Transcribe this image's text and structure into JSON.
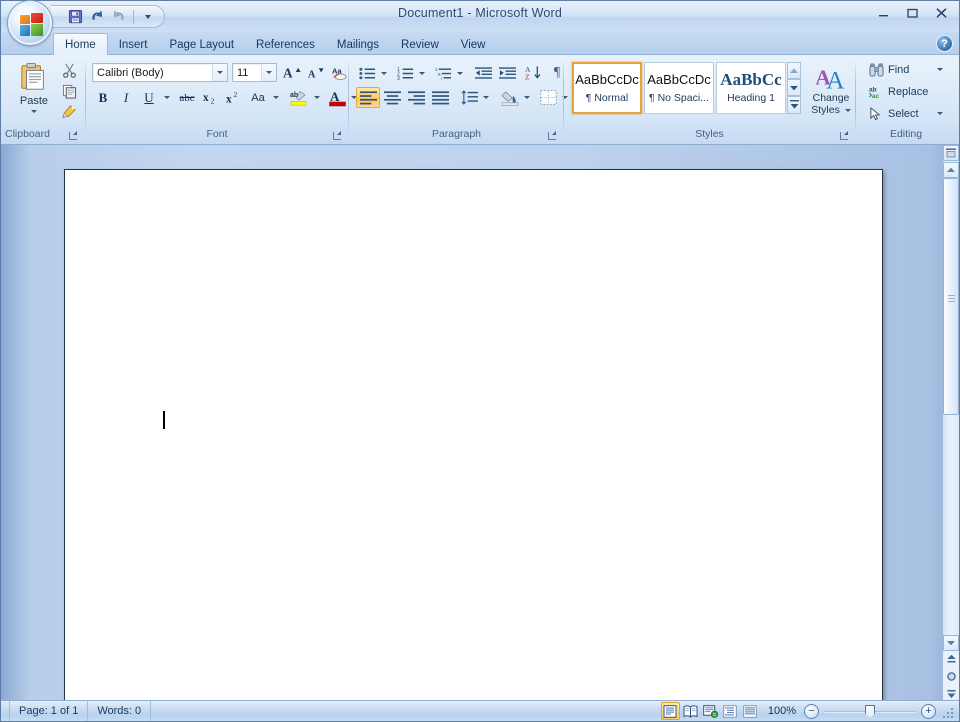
{
  "window": {
    "title": "Document1 - Microsoft Word",
    "minimize_label": "–",
    "maximize_label": "▭",
    "close_label": "✕",
    "help_label": "?"
  },
  "quick_access": {
    "items": [
      {
        "name": "save-button",
        "icon": "save-icon",
        "tooltip": "Save"
      },
      {
        "name": "undo-button",
        "icon": "undo-icon",
        "tooltip": "Undo"
      },
      {
        "name": "redo-button",
        "icon": "redo-icon",
        "tooltip": "Redo"
      },
      {
        "name": "customize-qat-button",
        "icon": "chevron-down-icon",
        "tooltip": "Customize Quick Access Toolbar"
      }
    ]
  },
  "office_button": {
    "name": "office-orb",
    "label": "Office Button"
  },
  "tabs": [
    {
      "label": "Home",
      "active": true
    },
    {
      "label": "Insert",
      "active": false
    },
    {
      "label": "Page Layout",
      "active": false
    },
    {
      "label": "References",
      "active": false
    },
    {
      "label": "Mailings",
      "active": false
    },
    {
      "label": "Review",
      "active": false
    },
    {
      "label": "View",
      "active": false
    }
  ],
  "ribbon": {
    "groups": [
      {
        "label": "Clipboard",
        "has_launcher": true
      },
      {
        "label": "Font",
        "has_launcher": true
      },
      {
        "label": "Paragraph",
        "has_launcher": true
      },
      {
        "label": "Styles",
        "has_launcher": true
      },
      {
        "label": "Editing",
        "has_launcher": false
      }
    ],
    "clipboard": {
      "paste_label": "Paste",
      "cut_icon": "scissors-icon",
      "copy_icon": "copy-icon",
      "format_painter_icon": "format-painter-icon"
    },
    "font": {
      "font_name": "Calibri (Body)",
      "font_size": "11",
      "grow_font_label": "A",
      "shrink_font_label": "A",
      "clear_formatting_label": "Aa",
      "bold_label": "B",
      "italic_label": "I",
      "underline_label": "U",
      "strikethrough_label": "abc",
      "subscript_label": "x",
      "subscript_sub": "2",
      "superscript_label": "x",
      "superscript_sup": "2",
      "change_case_label": "Aa",
      "highlight_label": "ab",
      "font_color_label": "A",
      "highlight_color": "#ffff00",
      "font_color": "#cc0000"
    },
    "paragraph": {
      "bullets_icon": "bullet-list-icon",
      "numbering_icon": "numbered-list-icon",
      "multilevel_icon": "multilevel-list-icon",
      "decrease_indent_icon": "decrease-indent-icon",
      "increase_indent_icon": "increase-indent-icon",
      "sort_icon": "sort-az-icon",
      "show_marks_label": "¶",
      "align_left_icon": "align-left-icon",
      "align_center_icon": "align-center-icon",
      "align_right_icon": "align-right-icon",
      "justify_icon": "justify-icon",
      "line_spacing_icon": "line-spacing-icon",
      "shading_icon": "shading-icon",
      "borders_icon": "borders-icon",
      "sort_top": "A",
      "sort_bottom": "Z"
    },
    "styles": {
      "items": [
        {
          "preview": "AaBbCcDc",
          "name": "¶ Normal",
          "selected": true,
          "style": "normal"
        },
        {
          "preview": "AaBbCcDc",
          "name": "¶ No Spaci...",
          "selected": false,
          "style": "normal"
        },
        {
          "preview": "AaBbCс",
          "name": "Heading 1",
          "selected": false,
          "style": "heading"
        }
      ],
      "change_styles_line1": "Change",
      "change_styles_line2": "Styles",
      "scroll_up_icon": "chevron-up-icon",
      "scroll_down_icon": "chevron-down-icon",
      "more_icon": "more-styles-icon"
    },
    "editing": {
      "find_label": "Find",
      "replace_label": "Replace",
      "select_label": "Select",
      "find_icon": "binoculars-icon",
      "replace_icon": "replace-icon",
      "select_icon": "cursor-arrow-icon"
    }
  },
  "document": {
    "content": "",
    "caret_visible": true
  },
  "scrollbar": {
    "up_icon": "triangle-up-icon",
    "down_icon": "triangle-down-icon",
    "previous_page_icon": "previous-page-icon",
    "select_browse_object_icon": "select-browse-object-icon",
    "next_page_icon": "next-page-icon",
    "split_icon": "split-window-icon"
  },
  "status_bar": {
    "page_label": "Page: 1 of 1",
    "words_label": "Words: 0",
    "views": [
      {
        "name": "print-layout-view",
        "icon": "print-layout-icon",
        "active": true
      },
      {
        "name": "full-screen-reading-view",
        "icon": "full-screen-reading-icon",
        "active": false
      },
      {
        "name": "web-layout-view",
        "icon": "web-layout-icon",
        "active": false
      },
      {
        "name": "outline-view",
        "icon": "outline-icon",
        "active": false
      },
      {
        "name": "draft-view",
        "icon": "draft-icon",
        "active": false
      }
    ],
    "zoom_level": "100%",
    "zoom_out_label": "−",
    "zoom_in_label": "+"
  },
  "colors": {
    "accent": "#e8a33d",
    "title_text": "#2c4d75",
    "ribbon_bg": "#dfecf9",
    "workspace_bg": "#bdd2ed",
    "page_bg": "#ffffff"
  }
}
